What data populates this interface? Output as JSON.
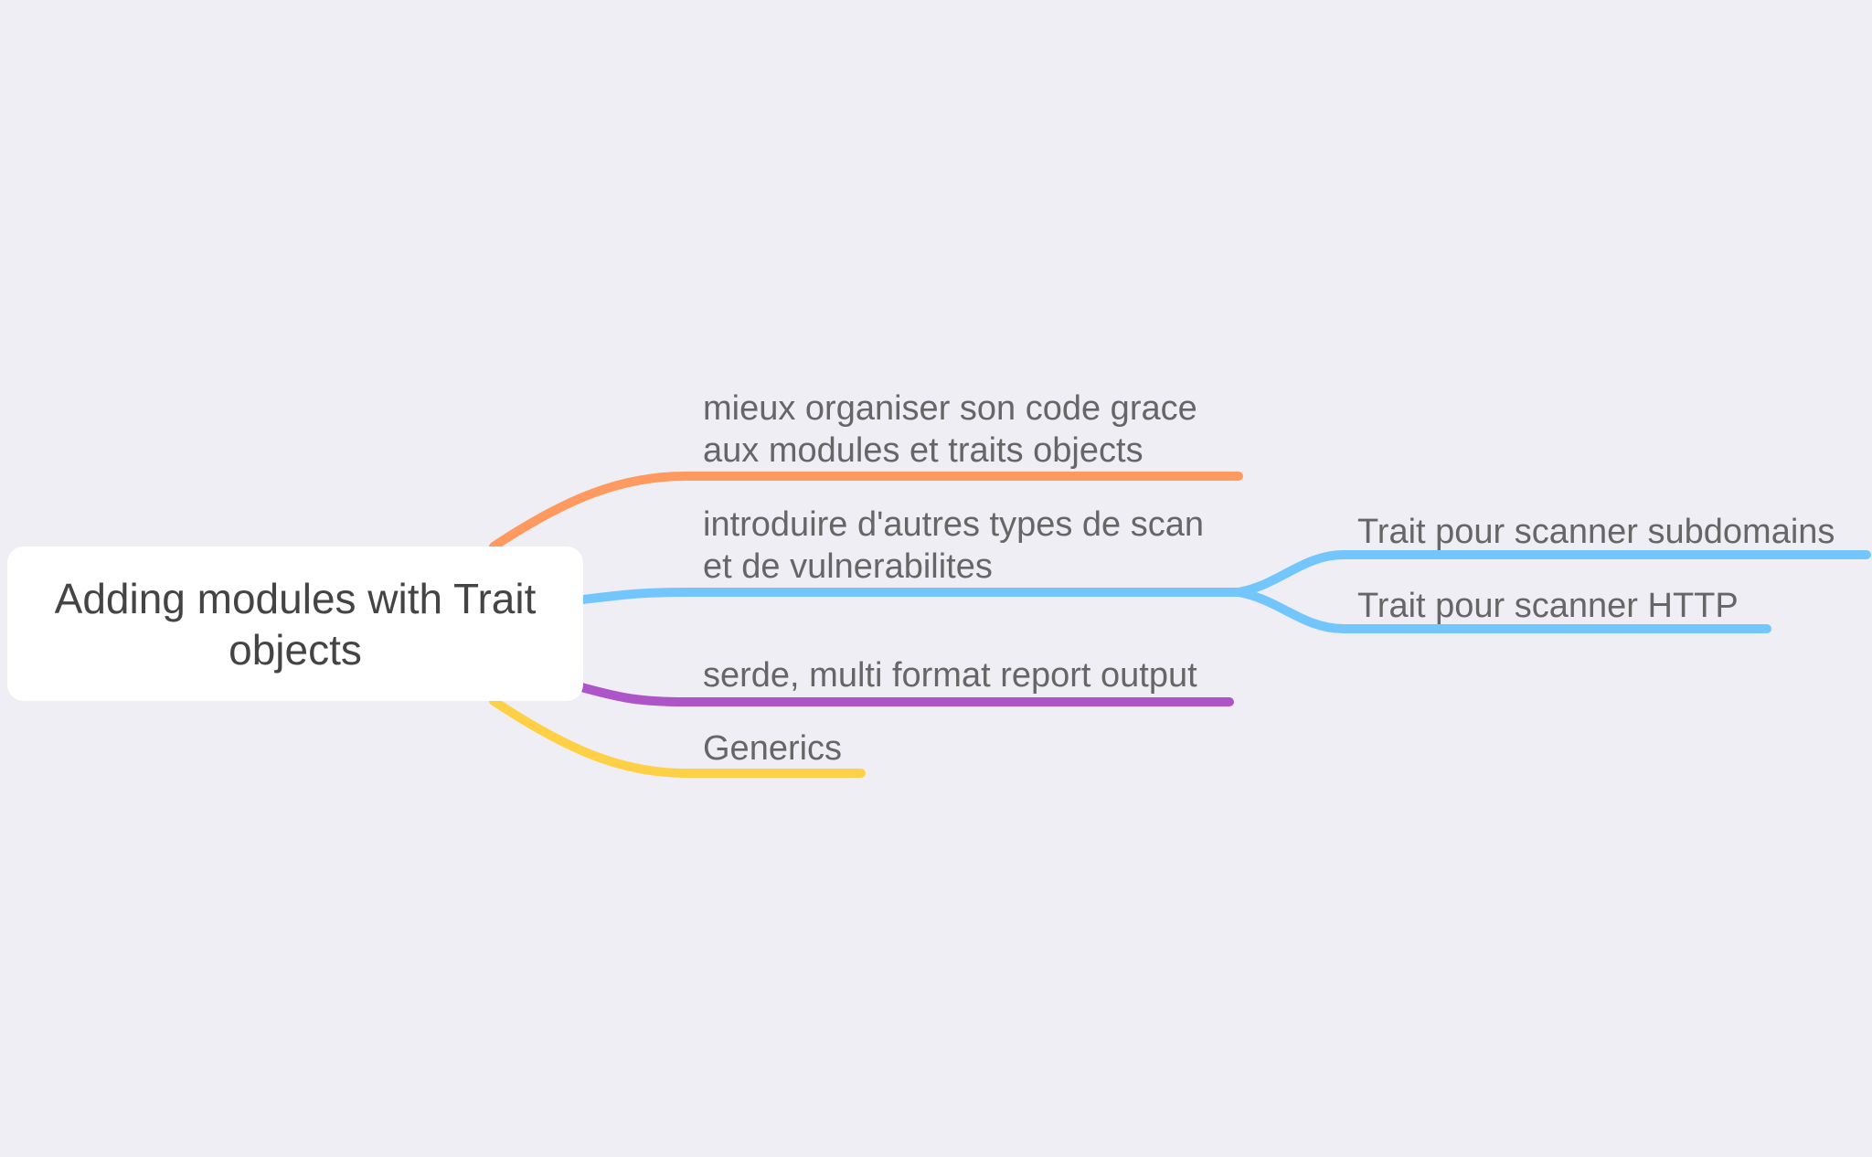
{
  "mindmap": {
    "root": {
      "title_line1": "Adding modules with Trait",
      "title_line2": "objects"
    },
    "branches": [
      {
        "id": "b1",
        "color": "#fe9a5f",
        "label_line1": "mieux organiser son code grace",
        "label_line2": "aux modules et traits objects"
      },
      {
        "id": "b2",
        "color": "#73c6fb",
        "label_line1": "introduire d'autres types de scan",
        "label_line2": "et de vulnerabilites",
        "children": [
          {
            "id": "b2c1",
            "label": "Trait pour scanner subdomains"
          },
          {
            "id": "b2c2",
            "label": "Trait pour scanner HTTP"
          }
        ]
      },
      {
        "id": "b3",
        "color": "#ad55c8",
        "label": "serde, multi format report output"
      },
      {
        "id": "b4",
        "color": "#fed045",
        "label": "Generics"
      }
    ]
  }
}
